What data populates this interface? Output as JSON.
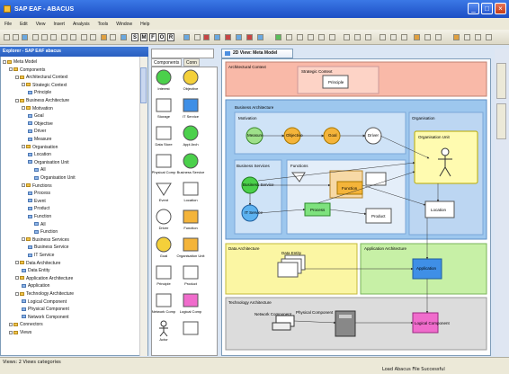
{
  "window": {
    "title": "SAP EAF - ABACUS"
  },
  "menu": [
    "File",
    "Edit",
    "View",
    "Insert",
    "Analysis",
    "Tools",
    "Window",
    "Help"
  ],
  "toolbar": {
    "text_buttons": [
      "S",
      "M",
      "F",
      "O",
      "R"
    ]
  },
  "explorer": {
    "title": "Explorer - SAP EAF abacus",
    "tree": [
      {
        "d": 0,
        "t": "Meta Model",
        "type": "fold"
      },
      {
        "d": 1,
        "t": "Components",
        "type": "fold"
      },
      {
        "d": 2,
        "t": "Architectural Context",
        "type": "fold"
      },
      {
        "d": 3,
        "t": "Strategic Context",
        "type": "fold"
      },
      {
        "d": 4,
        "t": "Principle",
        "type": "leaf"
      },
      {
        "d": 2,
        "t": "Business Architecture",
        "type": "fold"
      },
      {
        "d": 3,
        "t": "Motivation",
        "type": "fold"
      },
      {
        "d": 4,
        "t": "Goal",
        "type": "leaf"
      },
      {
        "d": 4,
        "t": "Objective",
        "type": "leaf"
      },
      {
        "d": 4,
        "t": "Driver",
        "type": "leaf"
      },
      {
        "d": 4,
        "t": "Measure",
        "type": "leaf"
      },
      {
        "d": 3,
        "t": "Organisation",
        "type": "fold"
      },
      {
        "d": 4,
        "t": "Location",
        "type": "leaf"
      },
      {
        "d": 4,
        "t": "Organisation Unit",
        "type": "leaf"
      },
      {
        "d": 5,
        "t": "All",
        "type": "leaf"
      },
      {
        "d": 5,
        "t": "Organisation Unit",
        "type": "leaf"
      },
      {
        "d": 3,
        "t": "Functions",
        "type": "fold"
      },
      {
        "d": 4,
        "t": "Process",
        "type": "leaf"
      },
      {
        "d": 4,
        "t": "Event",
        "type": "leaf"
      },
      {
        "d": 4,
        "t": "Product",
        "type": "leaf"
      },
      {
        "d": 4,
        "t": "Function",
        "type": "leaf"
      },
      {
        "d": 5,
        "t": "All",
        "type": "leaf"
      },
      {
        "d": 5,
        "t": "Function",
        "type": "leaf"
      },
      {
        "d": 3,
        "t": "Business Services",
        "type": "fold"
      },
      {
        "d": 4,
        "t": "Business Service",
        "type": "leaf"
      },
      {
        "d": 4,
        "t": "IT Service",
        "type": "leaf"
      },
      {
        "d": 2,
        "t": "Data Architecture",
        "type": "fold"
      },
      {
        "d": 3,
        "t": "Data Entity",
        "type": "leaf"
      },
      {
        "d": 2,
        "t": "Application Architecture",
        "type": "fold"
      },
      {
        "d": 3,
        "t": "Application",
        "type": "leaf"
      },
      {
        "d": 2,
        "t": "Technology Architecture",
        "type": "fold"
      },
      {
        "d": 3,
        "t": "Logical Component",
        "type": "leaf"
      },
      {
        "d": 3,
        "t": "Physical Component",
        "type": "leaf"
      },
      {
        "d": 3,
        "t": "Network Component",
        "type": "leaf"
      },
      {
        "d": 1,
        "t": "Connectors",
        "type": "fold"
      },
      {
        "d": 1,
        "t": "Views",
        "type": "fold"
      }
    ]
  },
  "palette": {
    "tabs": [
      "Components",
      "Conn"
    ],
    "items": [
      "Interest",
      "Objective",
      "Storage",
      "IT Service",
      "Data Store",
      "Appl Arch",
      "Physical Comp",
      "Business Service",
      "Event",
      "Location",
      "Driver",
      "Function",
      "Goal",
      "Organisation Unit",
      "Principle",
      "Product",
      "Network Comp",
      "Logical Comp",
      "Actor",
      ""
    ]
  },
  "doc": {
    "tab_label": "2D View: Meta Model",
    "canvas": {
      "arch_context": "Architectural Context",
      "strategic_context": "Strategic Context",
      "principle": "Principle",
      "business_arch": "Business Architecture",
      "motivation": "Motivation",
      "measure": "Measure",
      "objective": "Objective",
      "goal": "Goal",
      "driver": "Driver",
      "organisation": "Organisation",
      "org_unit": "Organisation Unit",
      "location": "Location",
      "business_services": "Business Services",
      "functions": "Functions",
      "business_service": "Business Service",
      "it_service": "IT Service",
      "process": "Process",
      "function": "Function",
      "product": "Product",
      "data_arch": "Data Architecture",
      "data_entity": "Data Entity",
      "app_arch": "Application Architecture",
      "application": "Application",
      "tech_arch": "Technology Architecture",
      "network_comp": "Network Component",
      "physical_comp": "Physical Component",
      "logical_comp": "Logical Component"
    }
  },
  "status": {
    "left": "Views: 2 Views categories",
    "right": "Load Abacus File Successful"
  }
}
